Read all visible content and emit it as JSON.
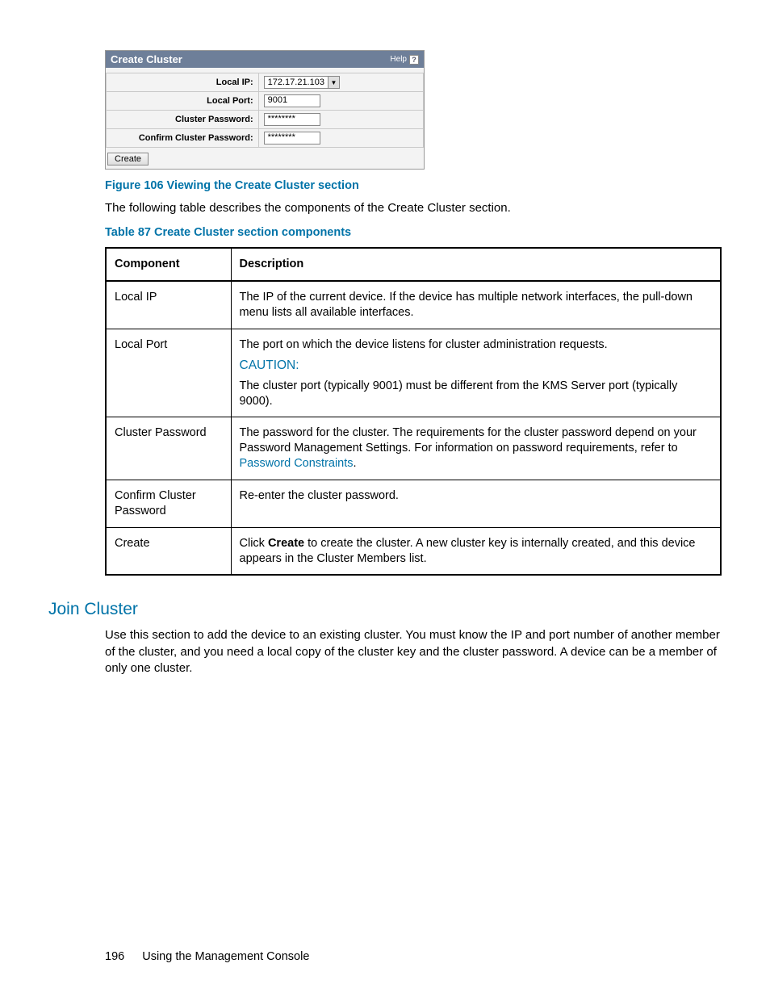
{
  "screenshot_panel": {
    "title": "Create Cluster",
    "help_label": "Help",
    "fields": {
      "local_ip_label": "Local IP:",
      "local_ip_value": "172.17.21.103",
      "local_port_label": "Local Port:",
      "local_port_value": "9001",
      "cluster_pw_label": "Cluster Password:",
      "cluster_pw_value": "********",
      "confirm_pw_label": "Confirm Cluster Password:",
      "confirm_pw_value": "********"
    },
    "create_button": "Create"
  },
  "figure_caption": "Figure 106 Viewing the Create Cluster section",
  "intro_text": "The following table describes the components of the Create Cluster section.",
  "table_caption": "Table 87 Create Cluster section components",
  "components_table": {
    "headers": {
      "c1": "Component",
      "c2": "Description"
    },
    "rows": {
      "r0": {
        "comp": "Local IP",
        "desc": "The IP of the current device. If the device has multiple network interfaces, the pull-down menu lists all available interfaces."
      },
      "r1": {
        "comp": "Local Port",
        "desc_line1": "The port on which the device listens for cluster administration requests.",
        "caution": "CAUTION:",
        "desc_line2": "The cluster port (typically 9001) must be different from the KMS Server port (typically 9000)."
      },
      "r2": {
        "comp": "Cluster Password",
        "desc_pre": "The password for the cluster. The requirements for the cluster password depend on your Password Management Settings. For information on password requirements, refer to ",
        "link": "Password Constraints",
        "desc_post": "."
      },
      "r3": {
        "comp": "Confirm Cluster Password",
        "desc": "Re-enter the cluster password."
      },
      "r4": {
        "comp": "Create",
        "desc_pre": "Click ",
        "bold": "Create",
        "desc_post": " to create the cluster. A new cluster key is internally created, and this device appears in the Cluster Members list."
      }
    }
  },
  "section_heading": "Join Cluster",
  "section_body": "Use this section to add the device to an existing cluster. You must know the IP and port number of another member of the cluster, and you need a local copy of the cluster key and the cluster password. A device can be a member of only one cluster.",
  "footer": {
    "page": "196",
    "title": "Using the Management Console"
  }
}
